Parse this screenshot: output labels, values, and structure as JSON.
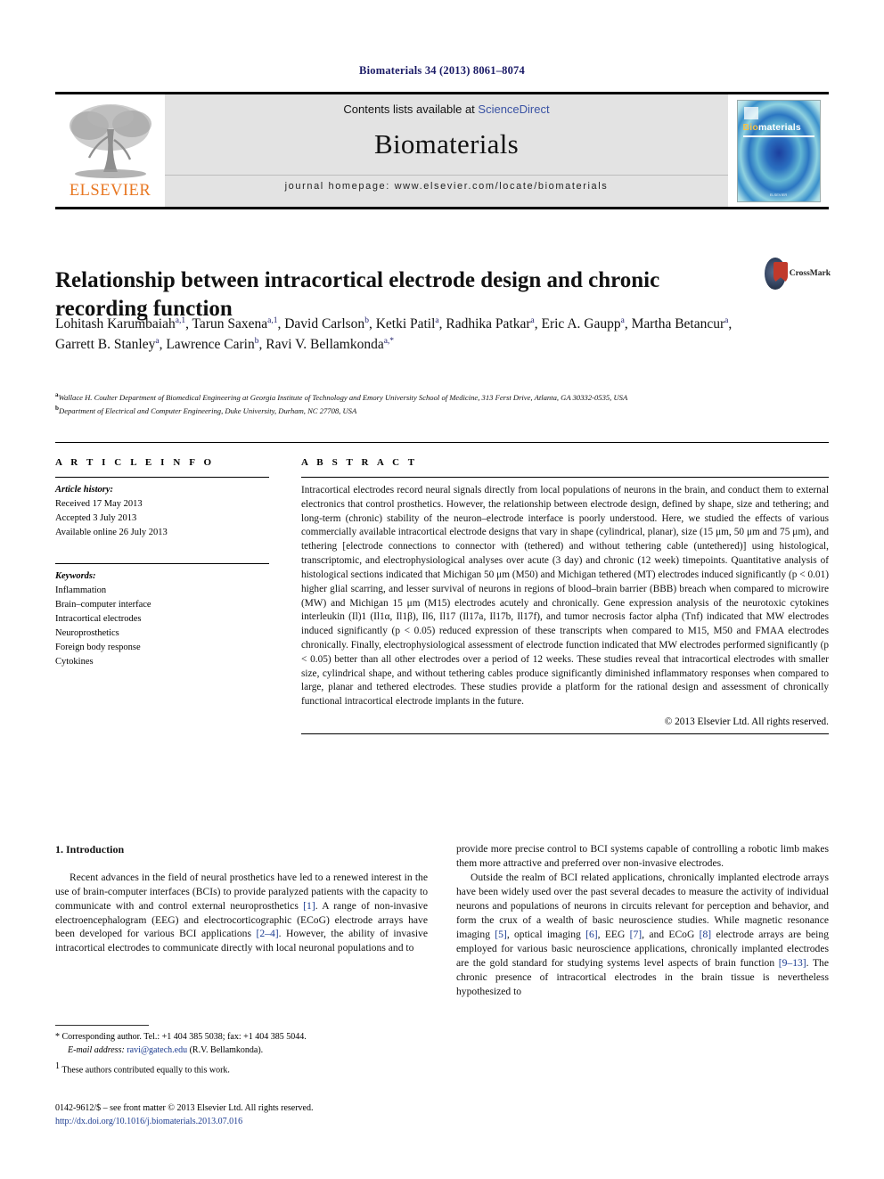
{
  "running_head": "Biomaterials 34 (2013) 8061–8074",
  "masthead": {
    "contents_prefix": "Contents lists available at ",
    "sciencedirect": "ScienceDirect",
    "journal_name": "Biomaterials",
    "homepage": "journal homepage: www.elsevier.com/locate/biomaterials",
    "publisher_logo_text": "ELSEVIER",
    "cover_title_bio": "Bio",
    "cover_title_rest": "materials",
    "cover_footer": "ELSEVIER"
  },
  "article": {
    "title": "Relationship between intracortical electrode design and chronic recording function",
    "crossmark_label": "CrossMark",
    "authors_html": "Lohitash Karumbaiah<sup>a,1</sup>, Tarun Saxena<sup>a,1</sup>, David Carlson<sup>b</sup>, Ketki Patil<sup>a</sup>, Radhika Patkar<sup>a</sup>, Eric A. Gaupp<sup>a</sup>, Martha Betancur<sup>a</sup>, Garrett B. Stanley<sup>a</sup>, Lawrence Carin<sup>b</sup>, Ravi V. Bellamkonda<sup>a,*</sup>",
    "affiliations_html": "<sup>a</sup>Wallace H. Coulter Department of Biomedical Engineering at Georgia Institute of Technology and Emory University School of Medicine, 313 Ferst Drive, Atlanta, GA 30332-0535, USA<br><sup>b</sup>Department of Electrical and Computer Engineering, Duke University, Durham, NC 27708, USA"
  },
  "article_info": {
    "heading": "A R T I C L E   I N F O",
    "history_label": "Article history:",
    "history": [
      "Received 17 May 2013",
      "Accepted 3 July 2013",
      "Available online 26 July 2013"
    ],
    "keywords_label": "Keywords:",
    "keywords": [
      "Inflammation",
      "Brain–computer interface",
      "Intracortical electrodes",
      "Neuroprosthetics",
      "Foreign body response",
      "Cytokines"
    ]
  },
  "abstract": {
    "heading": "A B S T R A C T",
    "text": "Intracortical electrodes record neural signals directly from local populations of neurons in the brain, and conduct them to external electronics that control prosthetics. However, the relationship between electrode design, defined by shape, size and tethering; and long-term (chronic) stability of the neuron–electrode interface is poorly understood. Here, we studied the effects of various commercially available intracortical electrode designs that vary in shape (cylindrical, planar), size (15 μm, 50 μm and 75 μm), and tethering [electrode connections to connector with (tethered) and without tethering cable (untethered)] using histological, transcriptomic, and electrophysiological analyses over acute (3 day) and chronic (12 week) timepoints. Quantitative analysis of histological sections indicated that Michigan 50 μm (M50) and Michigan tethered (MT) electrodes induced significantly (p < 0.01) higher glial scarring, and lesser survival of neurons in regions of blood–brain barrier (BBB) breach when compared to microwire (MW) and Michigan 15 μm (M15) electrodes acutely and chronically. Gene expression analysis of the neurotoxic cytokines interleukin (Il)1 (Il1α, Il1β), Il6, Il17 (Il17a, Il17b, Il17f), and tumor necrosis factor alpha (Tnf) indicated that MW electrodes induced significantly (p < 0.05) reduced expression of these transcripts when compared to M15, M50 and FMAA electrodes chronically. Finally, electrophysiological assessment of electrode function indicated that MW electrodes performed significantly (p < 0.05) better than all other electrodes over a period of 12 weeks. These studies reveal that intracortical electrodes with smaller size, cylindrical shape, and without tethering cables produce significantly diminished inflammatory responses when compared to large, planar and tethered electrodes. These studies provide a platform for the rational design and assessment of chronically functional intracortical electrode implants in the future.",
    "copyright": "© 2013 Elsevier Ltd. All rights reserved."
  },
  "introduction": {
    "section_number_title": "1. Introduction",
    "left_paragraph_1": "Recent advances in the field of neural prosthetics have led to a renewed interest in the use of brain-computer interfaces (BCIs) to provide paralyzed patients with the capacity to communicate with and control external neuroprosthetics [1]. A range of non-invasive electroencephalogram (EEG) and electrocorticographic (ECoG) electrode arrays have been developed for various BCI applications [2–4]. However, the ability of invasive intracortical electrodes to communicate directly with local neuronal populations and to",
    "right_paragraph_1": "provide more precise control to BCI systems capable of controlling a robotic limb makes them more attractive and preferred over non-invasive electrodes.",
    "right_paragraph_2": "Outside the realm of BCI related applications, chronically implanted electrode arrays have been widely used over the past several decades to measure the activity of individual neurons and populations of neurons in circuits relevant for perception and behavior, and form the crux of a wealth of basic neuroscience studies. While magnetic resonance imaging [5], optical imaging [6], EEG [7], and ECoG [8] electrode arrays are being employed for various basic neuroscience applications, chronically implanted electrodes are the gold standard for studying systems level aspects of brain function [9–13]. The chronic presence of intracortical electrodes in the brain tissue is nevertheless hypothesized to"
  },
  "footnotes": {
    "corresponding": "* Corresponding author. Tel.: +1 404 385 5038; fax: +1 404 385 5044.",
    "email_label": "E-mail address:",
    "email": "ravi@gatech.edu",
    "email_suffix": "(R.V. Bellamkonda).",
    "equal_contrib_mark": "1",
    "equal_contrib": "These authors contributed equally to this work."
  },
  "footer": {
    "issn_line": "0142-9612/$ – see front matter © 2013 Elsevier Ltd. All rights reserved.",
    "doi": "http://dx.doi.org/10.1016/j.biomaterials.2013.07.016"
  },
  "colors": {
    "journal_blue": "#1a1a66",
    "link_blue": "#1a3a8f",
    "elsevier_orange": "#e87722",
    "masthead_gray": "#e3e3e3"
  }
}
